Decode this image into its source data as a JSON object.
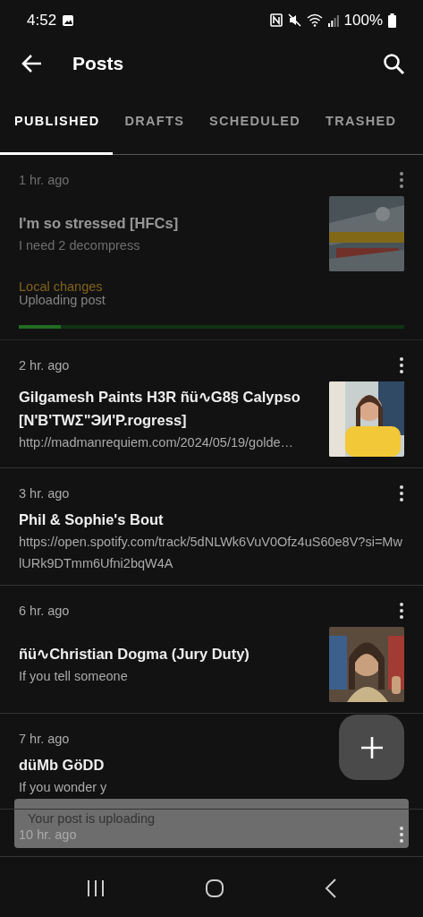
{
  "status_bar": {
    "time": "4:52",
    "battery": "100%"
  },
  "app_bar": {
    "title": "Posts"
  },
  "tabs": [
    {
      "label": "PUBLISHED",
      "selected": true
    },
    {
      "label": "DRAFTS",
      "selected": false
    },
    {
      "label": "SCHEDULED",
      "selected": false
    },
    {
      "label": "TRASHED",
      "selected": false
    }
  ],
  "posts": [
    {
      "time": "1 hr. ago",
      "title": "I'm so stressed [HFCs]",
      "excerpt": "I need 2 decompress",
      "dimmed": true,
      "local_changes": "Local changes",
      "upload_status": "Uploading post",
      "upload": {
        "level": 0.11
      }
    },
    {
      "time": "2 hr. ago",
      "title": "Gilgamesh Paints H3R ñü∿G8§ Calypso [N'B'TWΣ\"ЭИ'P.rogress]",
      "excerpt": "http://madmanrequiem.com/2024/05/19/golde…",
      "dimmed": false
    },
    {
      "time": "3 hr. ago",
      "title": "Phil & Sophie's Bout",
      "excerpt": "https://open.spotify.com/track/5dNLWk6VuV0Ofz4uS60e8V?si=MwlURk9DTmm6Ufni2bqW4A",
      "dimmed": false
    },
    {
      "time": "6 hr. ago",
      "title": "ñü∿Christian Dogma (Jury Duty)",
      "excerpt": "If you tell someone",
      "dimmed": false
    },
    {
      "time": "7 hr. ago",
      "title": "düMb GöDD",
      "excerpt": "If you wonder y",
      "dimmed": false
    },
    {
      "time": "10 hr. ago",
      "dimmed": false
    }
  ],
  "snackbar": {
    "message": "Your post is uploading"
  }
}
